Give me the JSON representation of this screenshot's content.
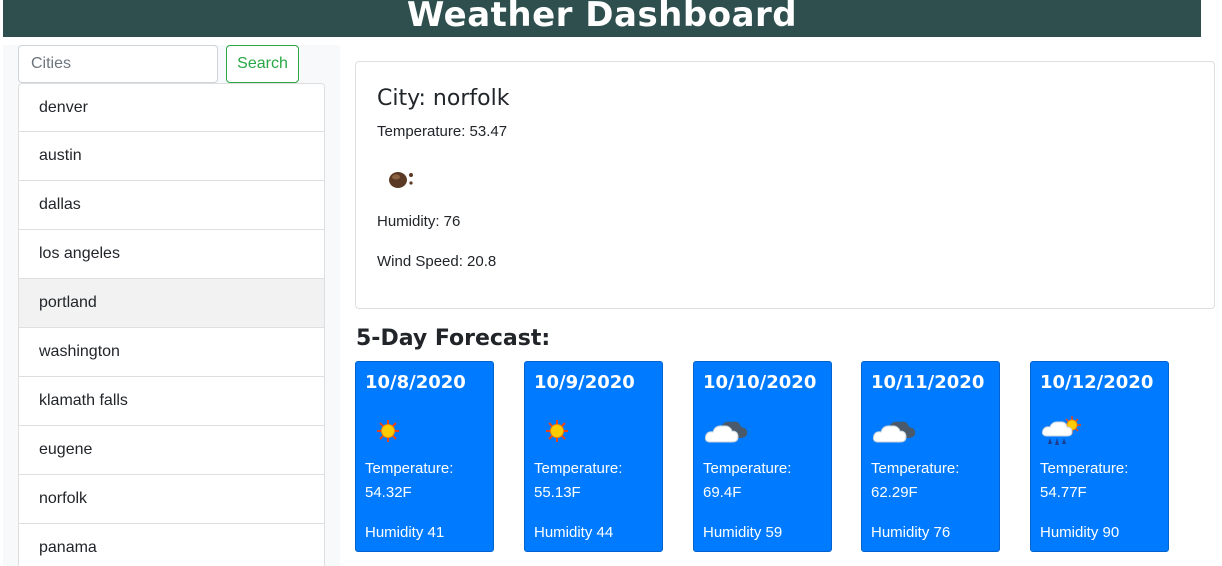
{
  "header": {
    "title": "Weather Dashboard"
  },
  "sidebar": {
    "search_placeholder": "Cities",
    "search_button_label": "Search",
    "cities": [
      "denver",
      "austin",
      "dallas",
      "los angeles",
      "portland",
      "washington",
      "klamath falls",
      "eugene",
      "norfolk",
      "panama"
    ]
  },
  "current": {
    "city_label": "City: norfolk",
    "temperature": "Temperature: 53.47",
    "icon": "fog-icon",
    "humidity": "Humidity: 76",
    "wind_speed": "Wind Speed: 20.8"
  },
  "forecast": {
    "title": "5-Day Forecast:",
    "days": [
      {
        "date": "10/8/2020",
        "icon": "sun-icon",
        "temp_label": "Temperature:",
        "temp_value": "54.32F",
        "humidity": "Humidity 41"
      },
      {
        "date": "10/9/2020",
        "icon": "sun-icon",
        "temp_label": "Temperature:",
        "temp_value": "55.13F",
        "humidity": "Humidity 44"
      },
      {
        "date": "10/10/2020",
        "icon": "cloud-icon",
        "temp_label": "Temperature:",
        "temp_value": "69.4F",
        "humidity": "Humidity 59"
      },
      {
        "date": "10/11/2020",
        "icon": "cloud-icon",
        "temp_label": "Temperature:",
        "temp_value": "62.29F",
        "humidity": "Humidity 76"
      },
      {
        "date": "10/12/2020",
        "icon": "rain-sun-icon",
        "temp_label": "Temperature:",
        "temp_value": "54.77F",
        "humidity": "Humidity 90"
      }
    ]
  },
  "colors": {
    "header_bg": "#2f4f4f",
    "card_bg": "#007bff",
    "search_button": "#28a745"
  }
}
